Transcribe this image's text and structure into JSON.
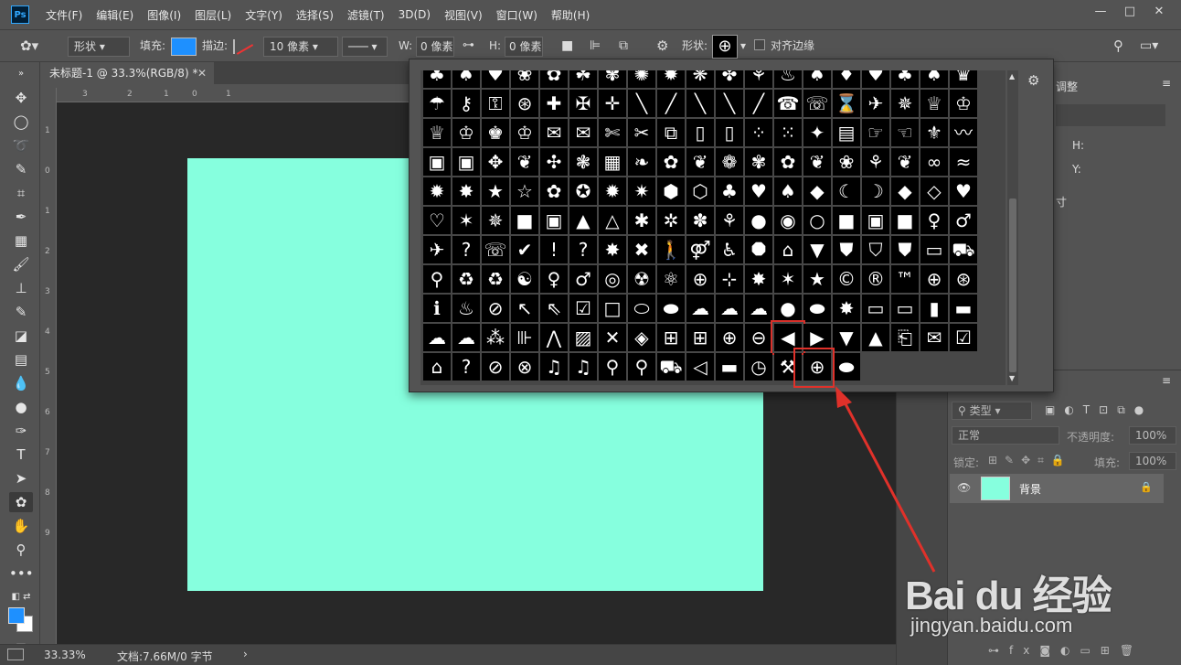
{
  "app": {
    "logo": "Ps"
  },
  "menu": [
    "文件(F)",
    "编辑(E)",
    "图像(I)",
    "图层(L)",
    "文字(Y)",
    "选择(S)",
    "滤镜(T)",
    "3D(D)",
    "视图(V)",
    "窗口(W)",
    "帮助(H)"
  ],
  "window_controls": {
    "minimize": "—",
    "maximize": "□",
    "close": "✕"
  },
  "options": {
    "mode": "形状",
    "fill_label": "填充:",
    "fill_color": "#1e90ff",
    "stroke_label": "描边:",
    "stroke_width": "10 像素",
    "w_label": "W:",
    "w_value": "0 像素",
    "h_label": "H:",
    "h_value": "0 像素",
    "shape_label": "形状:",
    "align_edges": "对齐边缘"
  },
  "document": {
    "tab_title": "未标题-1 @ 33.3%(RGB/8) *",
    "canvas_color": "#86ffde"
  },
  "ruler": {
    "top_ticks": [
      "3",
      "2",
      "1",
      "0",
      "1"
    ],
    "left_ticks": [
      "1",
      "0",
      "1",
      "2",
      "3",
      "4",
      "5",
      "6",
      "7",
      "8",
      "9"
    ]
  },
  "status": {
    "zoom": "33.33%",
    "doc_info": "文档:7.66M/0 字节"
  },
  "right_panel": {
    "tab_adjust": "调整",
    "h_label": "H:",
    "y_label": "Y:",
    "partial_text": "寸"
  },
  "layers": {
    "filter_kind": "类型",
    "blend_mode": "正常",
    "opacity_label": "不透明度:",
    "opacity_value": "100%",
    "lock_label": "锁定:",
    "fill_label": "填充:",
    "fill_value": "100%",
    "layer_name": "背景"
  },
  "shape_picker": {
    "shapes": [
      "♣",
      "♠",
      "♥",
      "❀",
      "✿",
      "☘",
      "✾",
      "✺",
      "✹",
      "❋",
      "✤",
      "⚘",
      "♨",
      "♠",
      "♦",
      "♥",
      "♣",
      "♠",
      "♛",
      "☂",
      "⚷",
      "⚿",
      "⊛",
      "✚",
      "✠",
      "✛",
      "╲",
      "╱",
      "╲",
      "╲",
      "╱",
      "☎",
      "☏",
      "⌛",
      "✈",
      "✵",
      "♕",
      "♔",
      "♕",
      "♔",
      "♚",
      "♔",
      "✉",
      "✉",
      "✄",
      "✂",
      "⧉",
      "▯",
      "▯",
      "⁘",
      "⁙",
      "✦",
      "▤",
      "☞",
      "☜",
      "⚜",
      "〰",
      "▣",
      "▣",
      "✥",
      "❦",
      "✣",
      "❃",
      "▦",
      "❧",
      "✿",
      "❦",
      "❁",
      "✾",
      "✿",
      "❦",
      "❀",
      "⚘",
      "❦",
      "∞",
      "≈",
      "✹",
      "✸",
      "★",
      "☆",
      "✿",
      "✪",
      "✹",
      "✷",
      "⬢",
      "⬡",
      "♣",
      "♥",
      "♠",
      "◆",
      "☾",
      "☽",
      "◆",
      "◇",
      "♥",
      "♡",
      "✶",
      "✵",
      "■",
      "▣",
      "▲",
      "△",
      "✱",
      "✲",
      "✽",
      "⚘",
      "●",
      "◉",
      "○",
      "■",
      "▣",
      "■",
      "♀",
      "♂",
      "✈",
      "?",
      "☏",
      "✔",
      "!",
      "?",
      "✸",
      "✖",
      "🚶",
      "⚤",
      "♿",
      "⯃",
      "⌂",
      "▼",
      "⛊",
      "⛉",
      "⛊",
      "▭",
      "⛟",
      "⚲",
      "♻",
      "♻",
      "☯",
      "♀",
      "♂",
      "◎",
      "☢",
      "⚛",
      "⊕",
      "⊹",
      "✸",
      "✶",
      "★",
      "©",
      "®",
      "™",
      "⊕",
      "⊛",
      "ℹ",
      "♨",
      "⊘",
      "↖",
      "⇖",
      "☑",
      "□",
      "⬭",
      "⬬",
      "☁",
      "☁",
      "☁",
      "●",
      "⬬",
      "✸",
      "▭",
      "▭",
      "▮",
      "▬",
      "☁",
      "☁",
      "⁂",
      "⊪",
      "⋀",
      "▨",
      "✕",
      "◈",
      "⊞",
      "⊞",
      "⊕",
      "⊖",
      "◀",
      "▶",
      "▼",
      "▲",
      "⎗",
      "✉",
      "☑",
      "⌂",
      "?",
      "⊘",
      "⊗",
      "♫",
      "♫",
      "⚲",
      "⚲",
      "⛟",
      "◁",
      "▬",
      "◷",
      "⚒",
      "⊕",
      "⬬"
    ],
    "selected_index": 183
  },
  "watermark": {
    "logo": "Bai du 经验",
    "url": "jingyan.baidu.com"
  },
  "annotation_color": "#e0312a"
}
